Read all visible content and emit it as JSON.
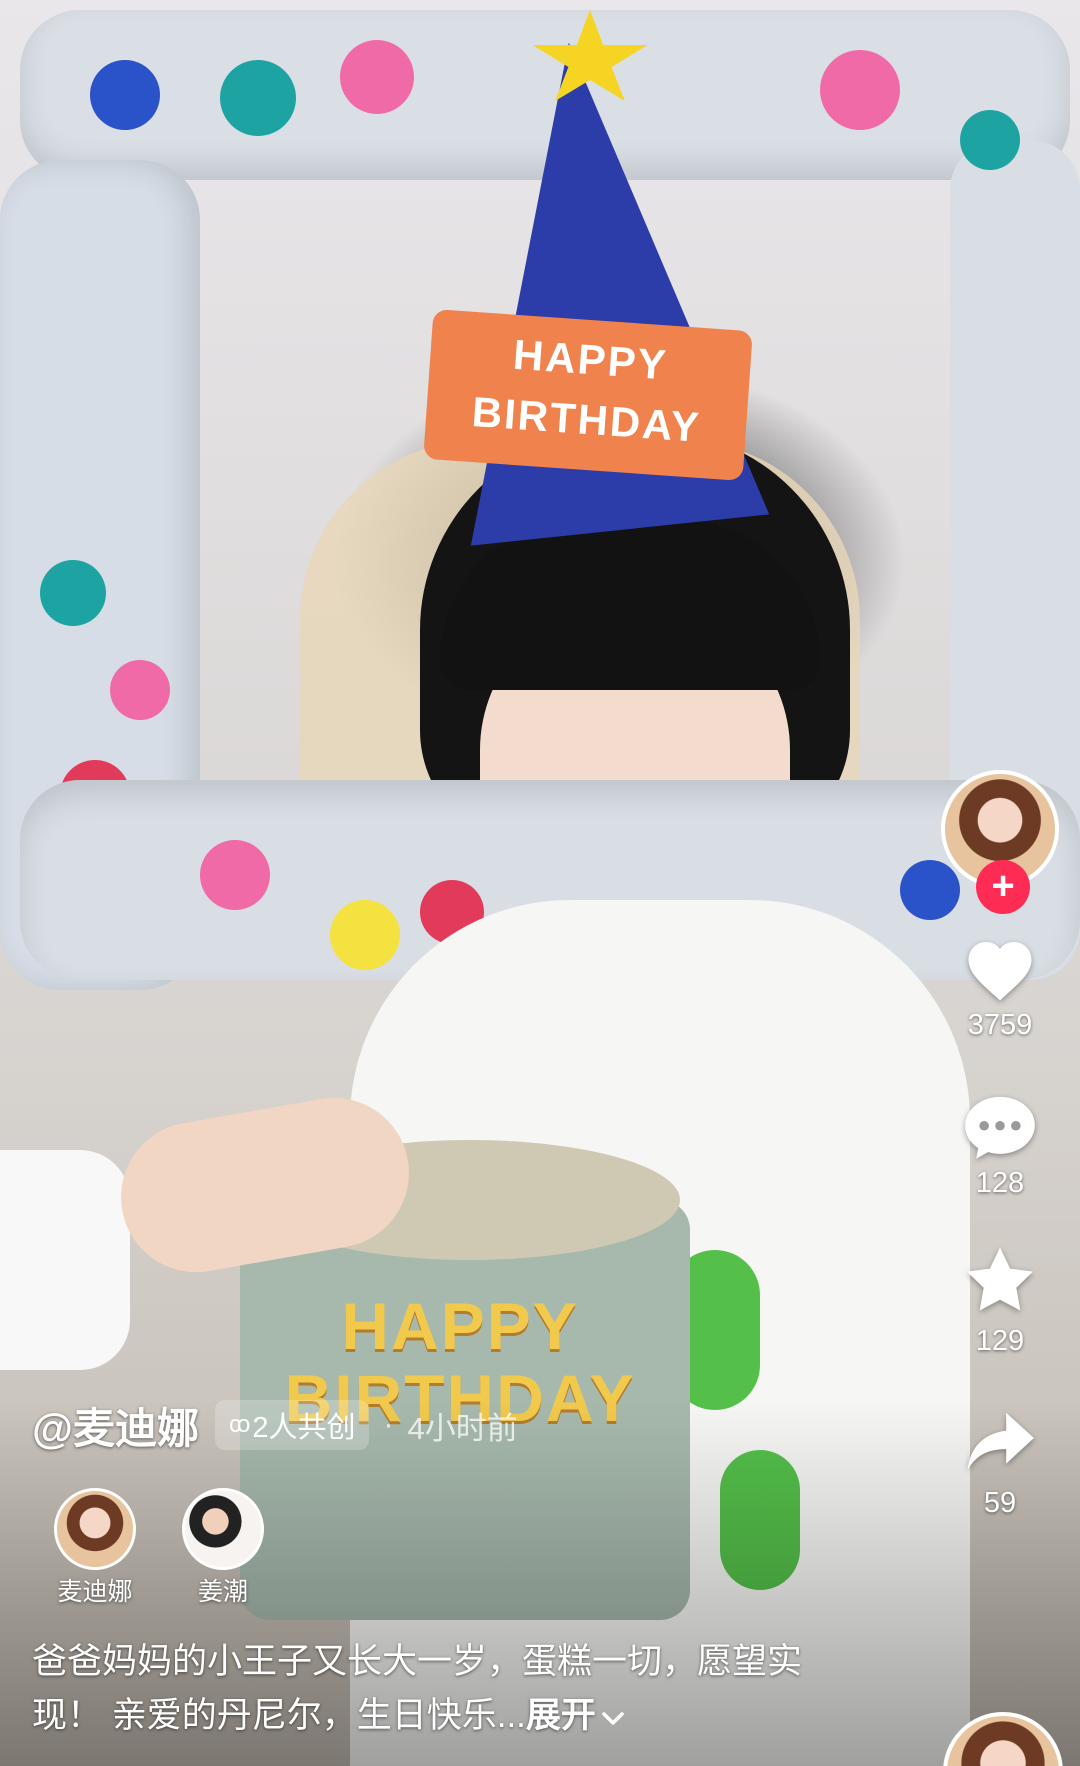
{
  "author": {
    "handle": "@麦迪娜",
    "cocreate_icon": "co",
    "cocreate_label": "2人共创",
    "separator": "·",
    "time_ago": "4小时前"
  },
  "creators": [
    {
      "name": "麦迪娜",
      "avatar_icon": "avatar-image"
    },
    {
      "name": "姜潮",
      "avatar_icon": "avatar-image"
    }
  ],
  "caption": {
    "text": "爸爸妈妈的小王子又长大一岁，蛋糕一切，愿望实现！ 亲爱的丹尼尔，生日快乐...",
    "expand_label": "展开",
    "expand_icon": "chevron-down-icon"
  },
  "right_rail": {
    "follow_symbol": "+",
    "likes": "3759",
    "comments": "128",
    "favorites": "129",
    "shares": "59"
  },
  "scene": {
    "hat_text": "HAPPY BIRTHDAY",
    "cake_topper_text": "HAPPY BIRTHDAY"
  },
  "colors": {
    "follow_red": "#fe2c55",
    "text_white": "#ffffff"
  }
}
